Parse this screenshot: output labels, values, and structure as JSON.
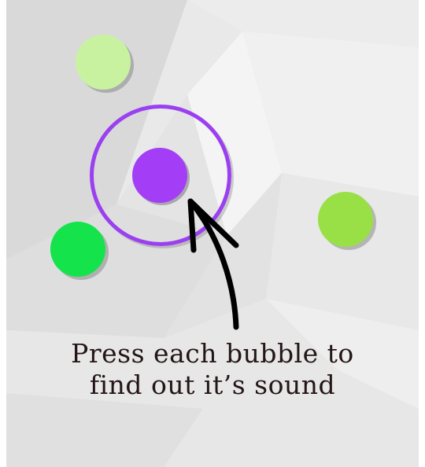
{
  "tutorial": {
    "hint_line1": "Press each bubble to",
    "hint_line2": "find out it’s sound"
  },
  "bubbles": [
    {
      "name": "light-green",
      "color": "#c8f2a0"
    },
    {
      "name": "purple",
      "color": "#a33ef6",
      "highlighted": true
    },
    {
      "name": "lime",
      "color": "#98e046"
    },
    {
      "name": "green",
      "color": "#14e34c"
    }
  ],
  "colors": {
    "background": "#e6e6e6",
    "highlight_ring": "#9b40f0",
    "arrow": "#000000",
    "text": "#241616"
  }
}
